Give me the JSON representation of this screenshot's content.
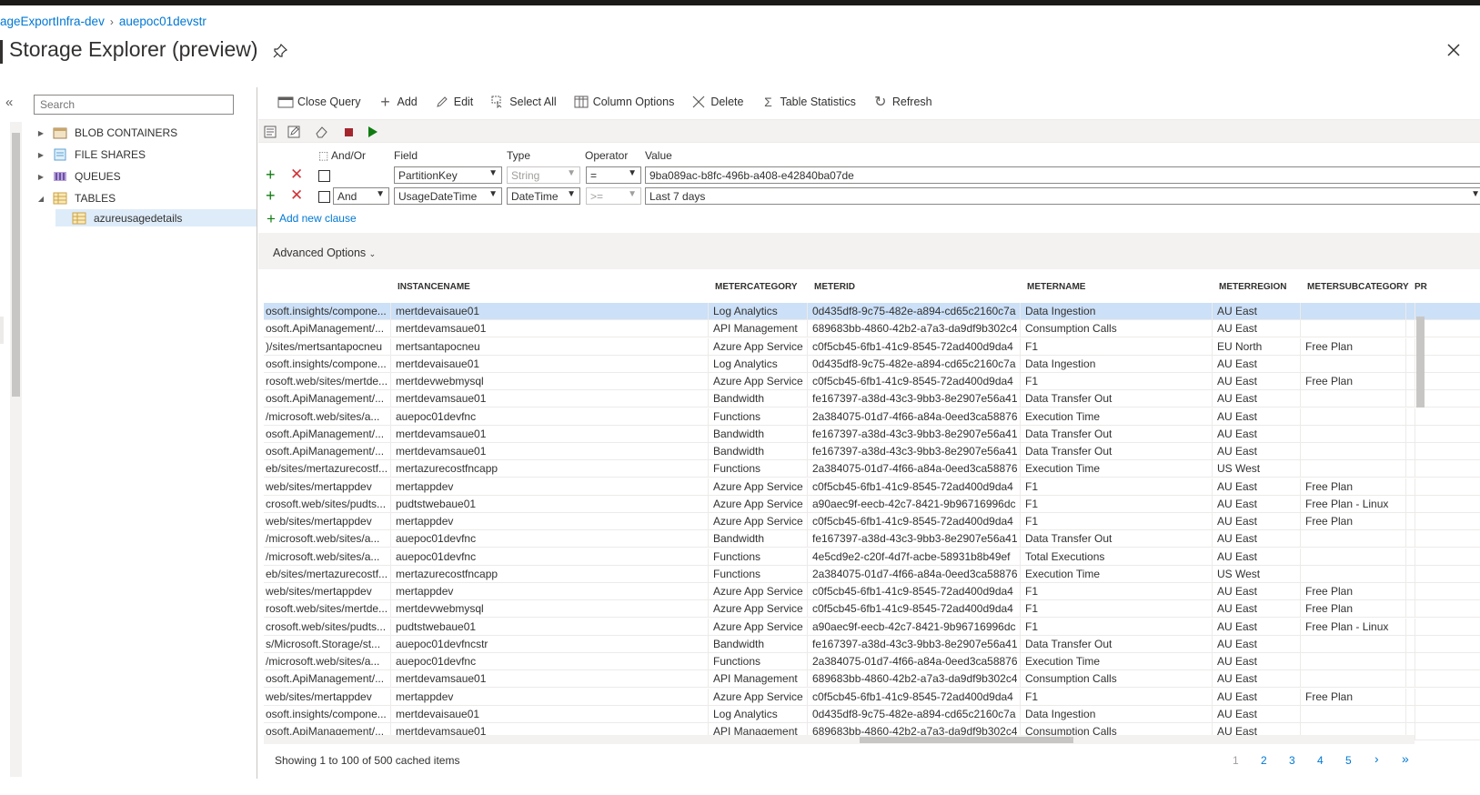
{
  "breadcrumb": {
    "items": [
      "ageExportInfra-dev",
      "auepoc01devstr"
    ]
  },
  "page": {
    "title": "Storage Explorer (preview)"
  },
  "sidebar": {
    "search_placeholder": "Search",
    "items": [
      {
        "label": "BLOB CONTAINERS",
        "icon": "blob-container-icon"
      },
      {
        "label": "FILE SHARES",
        "icon": "file-share-icon"
      },
      {
        "label": "QUEUES",
        "icon": "queue-icon"
      },
      {
        "label": "TABLES",
        "icon": "table-icon"
      }
    ],
    "child": {
      "label": "azureusagedetails",
      "icon": "table-icon"
    }
  },
  "toolbar": {
    "close_query": "Close Query",
    "add": "Add",
    "edit": "Edit",
    "select_all": "Select All",
    "column_options": "Column Options",
    "delete": "Delete",
    "table_statistics": "Table Statistics",
    "refresh": "Refresh"
  },
  "query": {
    "headers": {
      "and_or": "And/Or",
      "field": "Field",
      "type": "Type",
      "operator": "Operator",
      "value": "Value"
    },
    "clauses": [
      {
        "and_or": "",
        "field": "PartitionKey",
        "type": "String",
        "operator": "=",
        "value": "9ba089ac-b8fc-496b-a408-e42840ba07de"
      },
      {
        "and_or": "And",
        "field": "UsageDateTime",
        "type": "DateTime",
        "operator": ">=",
        "value": "Last 7 days"
      }
    ],
    "add_clause": "Add new clause",
    "advanced_options": "Advanced Options"
  },
  "grid": {
    "columns": [
      "INSTANCENAME",
      "METERCATEGORY",
      "METERID",
      "METERNAME",
      "METERREGION",
      "METERSUBCATEGORY",
      "PR"
    ],
    "rows": [
      [
        "osoft.insights/compone...",
        "mertdevaisaue01",
        "Log Analytics",
        "0d435df8-9c75-482e-a894-cd65c2160c7a",
        "Data Ingestion",
        "AU East",
        ""
      ],
      [
        "osoft.ApiManagement/...",
        "mertdevamsaue01",
        "API Management",
        "689683bb-4860-42b2-a7a3-da9df9b302c4",
        "Consumption Calls",
        "AU East",
        ""
      ],
      [
        ")/sites/mertsantapocneu",
        "mertsantapocneu",
        "Azure App Service",
        "c0f5cb45-6fb1-41c9-8545-72ad400d9da4",
        "F1",
        "EU North",
        "Free Plan"
      ],
      [
        "osoft.insights/compone...",
        "mertdevaisaue01",
        "Log Analytics",
        "0d435df8-9c75-482e-a894-cd65c2160c7a",
        "Data Ingestion",
        "AU East",
        ""
      ],
      [
        "rosoft.web/sites/mertde...",
        "mertdevwebmysql",
        "Azure App Service",
        "c0f5cb45-6fb1-41c9-8545-72ad400d9da4",
        "F1",
        "AU East",
        "Free Plan"
      ],
      [
        "osoft.ApiManagement/...",
        "mertdevamsaue01",
        "Bandwidth",
        "fe167397-a38d-43c3-9bb3-8e2907e56a41",
        "Data Transfer Out",
        "AU East",
        ""
      ],
      [
        "/microsoft.web/sites/a...",
        "auepoc01devfnc",
        "Functions",
        "2a384075-01d7-4f66-a84a-0eed3ca58876",
        "Execution Time",
        "AU East",
        ""
      ],
      [
        "osoft.ApiManagement/...",
        "mertdevamsaue01",
        "Bandwidth",
        "fe167397-a38d-43c3-9bb3-8e2907e56a41",
        "Data Transfer Out",
        "AU East",
        ""
      ],
      [
        "osoft.ApiManagement/...",
        "mertdevamsaue01",
        "Bandwidth",
        "fe167397-a38d-43c3-9bb3-8e2907e56a41",
        "Data Transfer Out",
        "AU East",
        ""
      ],
      [
        "eb/sites/mertazurecostf...",
        "mertazurecostfncapp",
        "Functions",
        "2a384075-01d7-4f66-a84a-0eed3ca58876",
        "Execution Time",
        "US West",
        ""
      ],
      [
        "web/sites/mertappdev",
        "mertappdev",
        "Azure App Service",
        "c0f5cb45-6fb1-41c9-8545-72ad400d9da4",
        "F1",
        "AU East",
        "Free Plan"
      ],
      [
        "crosoft.web/sites/pudts...",
        "pudtstwebaue01",
        "Azure App Service",
        "a90aec9f-eecb-42c7-8421-9b96716996dc",
        "F1",
        "AU East",
        "Free Plan - Linux"
      ],
      [
        "web/sites/mertappdev",
        "mertappdev",
        "Azure App Service",
        "c0f5cb45-6fb1-41c9-8545-72ad400d9da4",
        "F1",
        "AU East",
        "Free Plan"
      ],
      [
        "/microsoft.web/sites/a...",
        "auepoc01devfnc",
        "Bandwidth",
        "fe167397-a38d-43c3-9bb3-8e2907e56a41",
        "Data Transfer Out",
        "AU East",
        ""
      ],
      [
        "/microsoft.web/sites/a...",
        "auepoc01devfnc",
        "Functions",
        "4e5cd9e2-c20f-4d7f-acbe-58931b8b49ef",
        "Total Executions",
        "AU East",
        ""
      ],
      [
        "eb/sites/mertazurecostf...",
        "mertazurecostfncapp",
        "Functions",
        "2a384075-01d7-4f66-a84a-0eed3ca58876",
        "Execution Time",
        "US West",
        ""
      ],
      [
        "web/sites/mertappdev",
        "mertappdev",
        "Azure App Service",
        "c0f5cb45-6fb1-41c9-8545-72ad400d9da4",
        "F1",
        "AU East",
        "Free Plan"
      ],
      [
        "rosoft.web/sites/mertde...",
        "mertdevwebmysql",
        "Azure App Service",
        "c0f5cb45-6fb1-41c9-8545-72ad400d9da4",
        "F1",
        "AU East",
        "Free Plan"
      ],
      [
        "crosoft.web/sites/pudts...",
        "pudtstwebaue01",
        "Azure App Service",
        "a90aec9f-eecb-42c7-8421-9b96716996dc",
        "F1",
        "AU East",
        "Free Plan - Linux"
      ],
      [
        "s/Microsoft.Storage/st...",
        "auepoc01devfncstr",
        "Bandwidth",
        "fe167397-a38d-43c3-9bb3-8e2907e56a41",
        "Data Transfer Out",
        "AU East",
        ""
      ],
      [
        "/microsoft.web/sites/a...",
        "auepoc01devfnc",
        "Functions",
        "2a384075-01d7-4f66-a84a-0eed3ca58876",
        "Execution Time",
        "AU East",
        ""
      ],
      [
        "osoft.ApiManagement/...",
        "mertdevamsaue01",
        "API Management",
        "689683bb-4860-42b2-a7a3-da9df9b302c4",
        "Consumption Calls",
        "AU East",
        ""
      ],
      [
        "web/sites/mertappdev",
        "mertappdev",
        "Azure App Service",
        "c0f5cb45-6fb1-41c9-8545-72ad400d9da4",
        "F1",
        "AU East",
        "Free Plan"
      ],
      [
        "osoft.insights/compone...",
        "mertdevaisaue01",
        "Log Analytics",
        "0d435df8-9c75-482e-a894-cd65c2160c7a",
        "Data Ingestion",
        "AU East",
        ""
      ],
      [
        "osoft.ApiManagement/...",
        "mertdevamsaue01",
        "API Management",
        "689683bb-4860-42b2-a7a3-da9df9b302c4",
        "Consumption Calls",
        "AU East",
        ""
      ]
    ],
    "selected_row": 0
  },
  "status": {
    "text": "Showing 1 to 100 of 500 cached items"
  },
  "pager": {
    "pages": [
      "1",
      "2",
      "3",
      "4",
      "5"
    ],
    "next": "›",
    "last": "»"
  },
  "colors": {
    "accent": "#0078d4",
    "selection": "#cce0f7",
    "add_green": "#107c10",
    "delete_red": "#d13438"
  }
}
